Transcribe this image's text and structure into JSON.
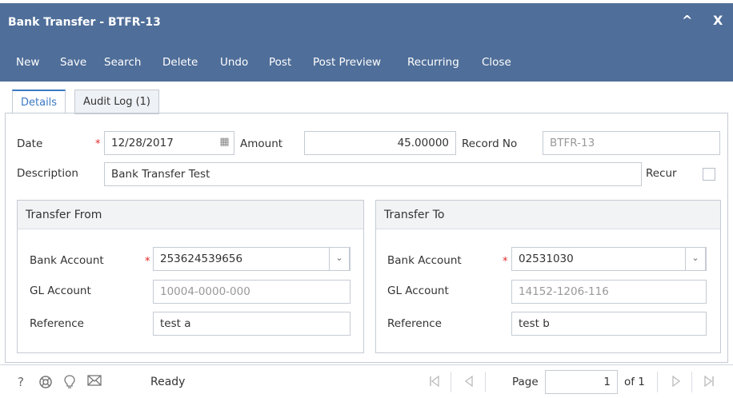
{
  "window": {
    "title": "Bank Transfer - BTFR-13",
    "collapse_icon": "^",
    "close_icon": "X"
  },
  "toolbar": {
    "new": "New",
    "save": "Save",
    "search": "Search",
    "delete": "Delete",
    "undo": "Undo",
    "post": "Post",
    "post_preview": "Post Preview",
    "recurring": "Recurring",
    "close": "Close"
  },
  "tabs": [
    {
      "label": "Details",
      "active": true
    },
    {
      "label": "Audit Log (1)",
      "active": false
    }
  ],
  "form": {
    "date_label": "Date",
    "date_value": "12/28/2017",
    "amount_label": "Amount",
    "amount_value": "45.00000",
    "record_no_label": "Record No",
    "record_no_value": "BTFR-13",
    "description_label": "Description",
    "description_value": "Bank Transfer Test",
    "recur_label": "Recur",
    "required_mark": "*"
  },
  "transfer_from": {
    "header": "Transfer From",
    "bank_account_label": "Bank Account",
    "bank_account_value": "253624539656",
    "gl_account_label": "GL Account",
    "gl_account_value": "10004-0000-000",
    "reference_label": "Reference",
    "reference_value": "test a"
  },
  "transfer_to": {
    "header": "Transfer To",
    "bank_account_label": "Bank Account",
    "bank_account_value": "02531030",
    "gl_account_label": "GL Account",
    "gl_account_value": "14152-1206-116",
    "reference_label": "Reference",
    "reference_value": "test b"
  },
  "statusbar": {
    "help_icon": "?",
    "status_text": "Ready",
    "page_label": "Page",
    "page_value": "1",
    "of_label": "of 1"
  },
  "colors": {
    "header_bg": "#4f6e99",
    "required": "#e02828",
    "active_tab": "#3a78c4"
  }
}
